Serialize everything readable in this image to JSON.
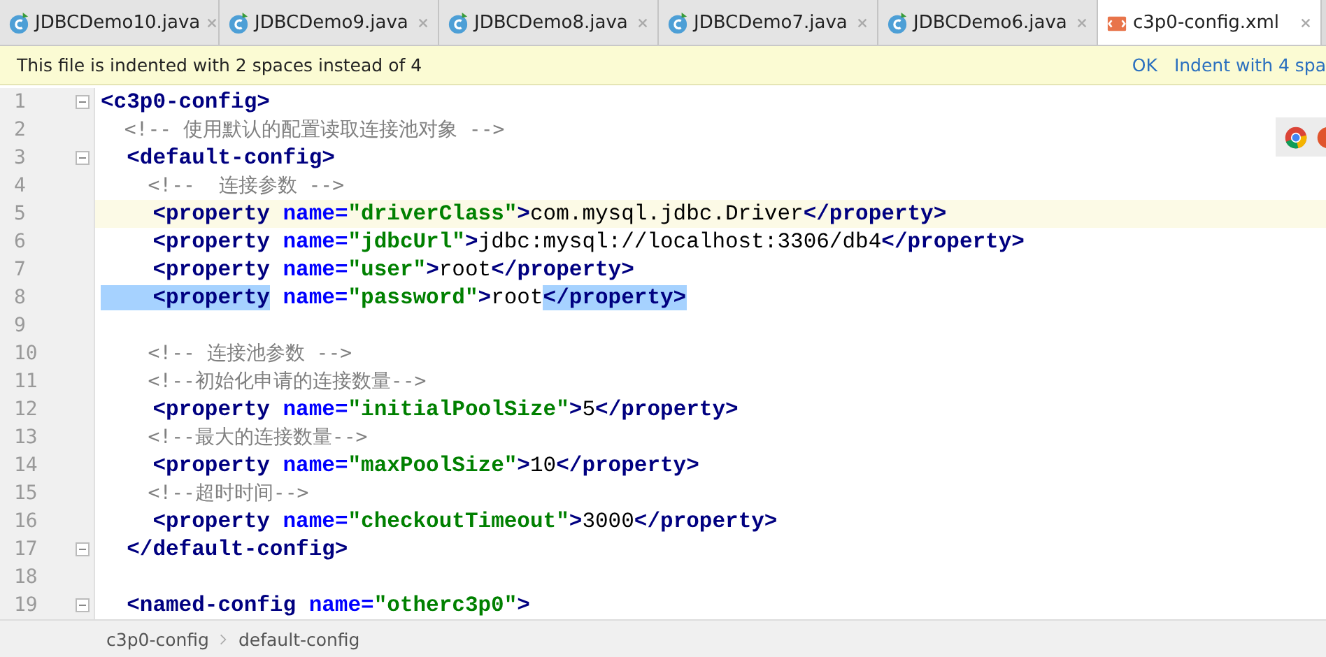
{
  "tabs": [
    {
      "label": "JDBCDemo10.java",
      "kind": "java",
      "selected": false
    },
    {
      "label": "JDBCDemo9.java",
      "kind": "java",
      "selected": false
    },
    {
      "label": "JDBCDemo8.java",
      "kind": "java",
      "selected": false
    },
    {
      "label": "JDBCDemo7.java",
      "kind": "java",
      "selected": false
    },
    {
      "label": "JDBCDemo6.java",
      "kind": "java",
      "selected": false
    },
    {
      "label": "c3p0-config.xml",
      "kind": "xml",
      "selected": true
    }
  ],
  "notice": {
    "message": "This file is indented with 2 spaces instead of 4",
    "actions": [
      "OK",
      "Indent with 4 spa"
    ]
  },
  "lines": [
    {
      "number": "1",
      "fold": true,
      "current": false,
      "tokens": [
        {
          "kind": "tag",
          "text": "<c3p0-config>",
          "highlight": false
        }
      ]
    },
    {
      "number": "2",
      "fold": false,
      "current": false,
      "tokens": [
        {
          "kind": "comment",
          "text": "  <!-- 使用默认的配置读取连接池对象 -->",
          "highlight": false
        }
      ]
    },
    {
      "number": "3",
      "fold": true,
      "current": false,
      "tokens": [
        {
          "kind": "tag",
          "text": "  <default-config>",
          "highlight": false
        }
      ]
    },
    {
      "number": "4",
      "fold": false,
      "current": false,
      "tokens": [
        {
          "kind": "comment",
          "text": "    <!--  连接参数 -->",
          "highlight": false
        }
      ]
    },
    {
      "number": "5",
      "fold": false,
      "current": true,
      "tokens": [
        {
          "kind": "tag",
          "text": "    <property ",
          "highlight": false
        },
        {
          "kind": "attr",
          "text": "name=",
          "highlight": false
        },
        {
          "kind": "value",
          "text": "\"driverClass\"",
          "highlight": false
        },
        {
          "kind": "tag",
          "text": ">",
          "highlight": false
        },
        {
          "kind": "text",
          "text": "com.mysql.jdbc.Driver",
          "highlight": false
        },
        {
          "kind": "tag",
          "text": "</property>",
          "highlight": false
        }
      ]
    },
    {
      "number": "6",
      "fold": false,
      "current": false,
      "tokens": [
        {
          "kind": "tag",
          "text": "    <property ",
          "highlight": false
        },
        {
          "kind": "attr",
          "text": "name=",
          "highlight": false
        },
        {
          "kind": "value",
          "text": "\"jdbcUrl\"",
          "highlight": false
        },
        {
          "kind": "tag",
          "text": ">",
          "highlight": false
        },
        {
          "kind": "text",
          "text": "jdbc:mysql://localhost:3306/db4",
          "highlight": false
        },
        {
          "kind": "tag",
          "text": "</property>",
          "highlight": false
        }
      ]
    },
    {
      "number": "7",
      "fold": false,
      "current": false,
      "tokens": [
        {
          "kind": "tag",
          "text": "    <property ",
          "highlight": false
        },
        {
          "kind": "attr",
          "text": "name=",
          "highlight": false
        },
        {
          "kind": "value",
          "text": "\"user\"",
          "highlight": false
        },
        {
          "kind": "tag",
          "text": ">",
          "highlight": false
        },
        {
          "kind": "text",
          "text": "root",
          "highlight": false
        },
        {
          "kind": "tag",
          "text": "</property>",
          "highlight": false
        }
      ]
    },
    {
      "number": "8",
      "fold": false,
      "current": false,
      "tokens": [
        {
          "kind": "tag",
          "text": "    <property",
          "highlight": true
        },
        {
          "kind": "attr",
          "text": " name=",
          "highlight": false
        },
        {
          "kind": "value",
          "text": "\"password\"",
          "highlight": false
        },
        {
          "kind": "tag",
          "text": ">",
          "highlight": false
        },
        {
          "kind": "text",
          "text": "root",
          "highlight": false
        },
        {
          "kind": "tag",
          "text": "</property>",
          "highlight": true
        }
      ]
    },
    {
      "number": "9",
      "fold": false,
      "current": false
    },
    {
      "number": "10",
      "fold": false,
      "current": false,
      "tokens": [
        {
          "kind": "comment",
          "text": "    <!-- 连接池参数 -->",
          "highlight": false
        }
      ]
    },
    {
      "number": "11",
      "fold": false,
      "current": false,
      "tokens": [
        {
          "kind": "comment",
          "text": "    <!--初始化申请的连接数量-->",
          "highlight": false
        }
      ]
    },
    {
      "number": "12",
      "fold": false,
      "current": false,
      "tokens": [
        {
          "kind": "tag",
          "text": "    <property ",
          "highlight": false
        },
        {
          "kind": "attr",
          "text": "name=",
          "highlight": false
        },
        {
          "kind": "value",
          "text": "\"initialPoolSize\"",
          "highlight": false
        },
        {
          "kind": "tag",
          "text": ">",
          "highlight": false
        },
        {
          "kind": "text",
          "text": "5",
          "highlight": false
        },
        {
          "kind": "tag",
          "text": "</property>",
          "highlight": false
        }
      ]
    },
    {
      "number": "13",
      "fold": false,
      "current": false,
      "tokens": [
        {
          "kind": "comment",
          "text": "    <!--最大的连接数量-->",
          "highlight": false
        }
      ]
    },
    {
      "number": "14",
      "fold": false,
      "current": false,
      "tokens": [
        {
          "kind": "tag",
          "text": "    <property ",
          "highlight": false
        },
        {
          "kind": "attr",
          "text": "name=",
          "highlight": false
        },
        {
          "kind": "value",
          "text": "\"maxPoolSize\"",
          "highlight": false
        },
        {
          "kind": "tag",
          "text": ">",
          "highlight": false
        },
        {
          "kind": "text",
          "text": "10",
          "highlight": false
        },
        {
          "kind": "tag",
          "text": "</property>",
          "highlight": false
        }
      ]
    },
    {
      "number": "15",
      "fold": false,
      "current": false,
      "tokens": [
        {
          "kind": "comment",
          "text": "    <!--超时时间-->",
          "highlight": false
        }
      ]
    },
    {
      "number": "16",
      "fold": false,
      "current": false,
      "tokens": [
        {
          "kind": "tag",
          "text": "    <property ",
          "highlight": false
        },
        {
          "kind": "attr",
          "text": "name=",
          "highlight": false
        },
        {
          "kind": "value",
          "text": "\"checkoutTimeout\"",
          "highlight": false
        },
        {
          "kind": "tag",
          "text": ">",
          "highlight": false
        },
        {
          "kind": "text",
          "text": "3000",
          "highlight": false
        },
        {
          "kind": "tag",
          "text": "</property>",
          "highlight": false
        }
      ]
    },
    {
      "number": "17",
      "fold": true,
      "current": false,
      "tokens": [
        {
          "kind": "tag",
          "text": "  </default-config>",
          "highlight": false
        }
      ]
    },
    {
      "number": "18",
      "fold": false,
      "current": false
    },
    {
      "number": "19",
      "fold": true,
      "current": false,
      "tokens": [
        {
          "kind": "tag",
          "text": "  <named-config ",
          "highlight": false
        },
        {
          "kind": "attr",
          "text": "name=",
          "highlight": false
        },
        {
          "kind": "value",
          "text": "\"otherc3p0\"",
          "highlight": false
        },
        {
          "kind": "tag",
          "text": ">",
          "highlight": false
        }
      ]
    }
  ],
  "breadcrumbs": [
    "c3p0-config",
    "default-config"
  ]
}
